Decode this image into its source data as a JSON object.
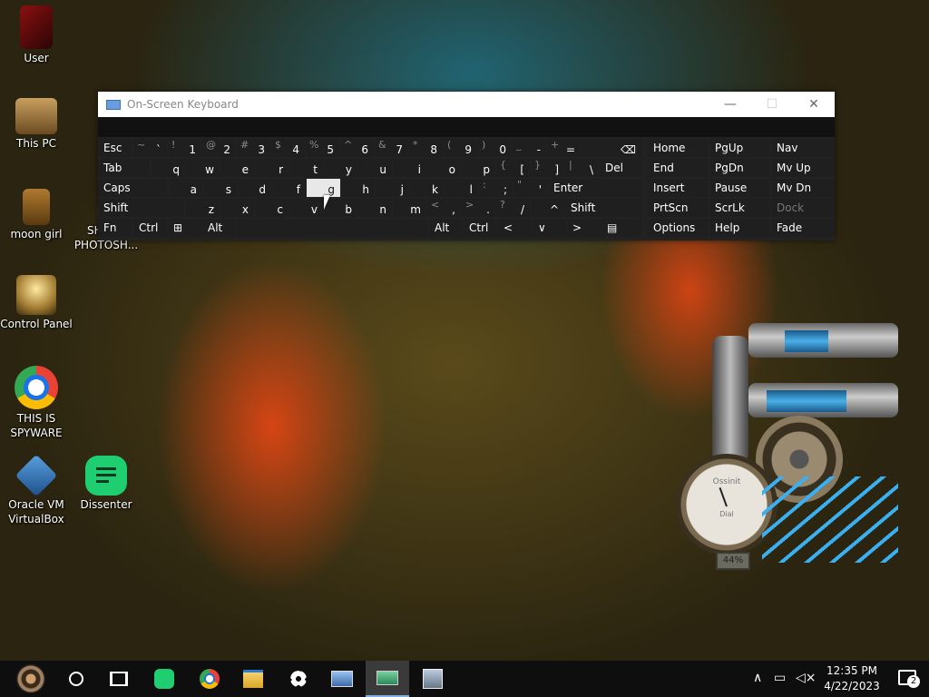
{
  "desktop_icons": [
    {
      "label": "User",
      "icon": "user-folder-icon"
    },
    {
      "label": "This PC",
      "icon": "computer-icon"
    },
    {
      "label": "moon girl",
      "icon": "folder-icon"
    },
    {
      "label": "SHITTY PHOTOSH...",
      "icon": "photoshop-icon"
    },
    {
      "label": "Control Panel",
      "icon": "control-panel-icon"
    },
    {
      "label": "THIS IS SPYWARE",
      "icon": "chrome-icon"
    },
    {
      "label": "Oracle VM VirtualBox",
      "icon": "virtualbox-icon"
    },
    {
      "label": "Dissenter",
      "icon": "dissenter-icon"
    }
  ],
  "osk": {
    "title": "On-Screen Keyboard",
    "rows": [
      [
        {
          "m": "Esc"
        },
        {
          "s": "~",
          "m": "`"
        },
        {
          "s": "!",
          "m": "1"
        },
        {
          "s": "@",
          "m": "2"
        },
        {
          "s": "#",
          "m": "3"
        },
        {
          "s": "$",
          "m": "4"
        },
        {
          "s": "%",
          "m": "5"
        },
        {
          "s": "^",
          "m": "6"
        },
        {
          "s": "&",
          "m": "7"
        },
        {
          "s": "*",
          "m": "8"
        },
        {
          "s": "(",
          "m": "9"
        },
        {
          "s": ")",
          "m": "0"
        },
        {
          "s": "_",
          "m": "-"
        },
        {
          "s": "+",
          "m": "="
        },
        {
          "m": "⌫"
        }
      ],
      [
        {
          "m": "Tab"
        },
        {
          "m": "q"
        },
        {
          "m": "w"
        },
        {
          "m": "e"
        },
        {
          "m": "r"
        },
        {
          "m": "t"
        },
        {
          "m": "y"
        },
        {
          "m": "u"
        },
        {
          "m": "i"
        },
        {
          "m": "o"
        },
        {
          "m": "p"
        },
        {
          "s": "{",
          "m": "["
        },
        {
          "s": "}",
          "m": "]"
        },
        {
          "s": "|",
          "m": "\\"
        },
        {
          "m": "Del"
        }
      ],
      [
        {
          "m": "Caps"
        },
        {
          "m": "a"
        },
        {
          "m": "s"
        },
        {
          "m": "d"
        },
        {
          "m": "f"
        },
        {
          "m": "g"
        },
        {
          "m": "h"
        },
        {
          "m": "j"
        },
        {
          "m": "k"
        },
        {
          "m": "l"
        },
        {
          "s": ":",
          "m": ";"
        },
        {
          "s": "\"",
          "m": "'"
        },
        {
          "m": "Enter"
        }
      ],
      [
        {
          "m": "Shift"
        },
        {
          "m": "z"
        },
        {
          "m": "x"
        },
        {
          "m": "c"
        },
        {
          "m": "v"
        },
        {
          "m": "b"
        },
        {
          "m": "n"
        },
        {
          "m": "m"
        },
        {
          "s": "<",
          "m": ","
        },
        {
          "s": ">",
          "m": "."
        },
        {
          "s": "?",
          "m": "/"
        },
        {
          "m": "^"
        },
        {
          "m": "Shift"
        }
      ],
      [
        {
          "m": "Fn"
        },
        {
          "m": "Ctrl"
        },
        {
          "m": "⊞"
        },
        {
          "m": "Alt"
        },
        {
          "m": ""
        },
        {
          "m": "Alt"
        },
        {
          "m": "Ctrl"
        },
        {
          "m": "<"
        },
        {
          "m": "∨"
        },
        {
          "m": ">"
        },
        {
          "m": "▤"
        }
      ]
    ],
    "nav_keys": [
      [
        "Home",
        "PgUp",
        "Nav"
      ],
      [
        "End",
        "PgDn",
        "Mv Up"
      ],
      [
        "Insert",
        "Pause",
        "Mv Dn"
      ],
      [
        "PrtScn",
        "ScrLk",
        "Dock"
      ],
      [
        "Options",
        "Help",
        "Fade"
      ]
    ]
  },
  "widget": {
    "gauge_title": "Ossinit",
    "gauge_sub": "Dial",
    "percent": "44%"
  },
  "taskbar": {
    "time": "12:35 PM",
    "date": "4/22/2023",
    "notification_count": "2"
  }
}
